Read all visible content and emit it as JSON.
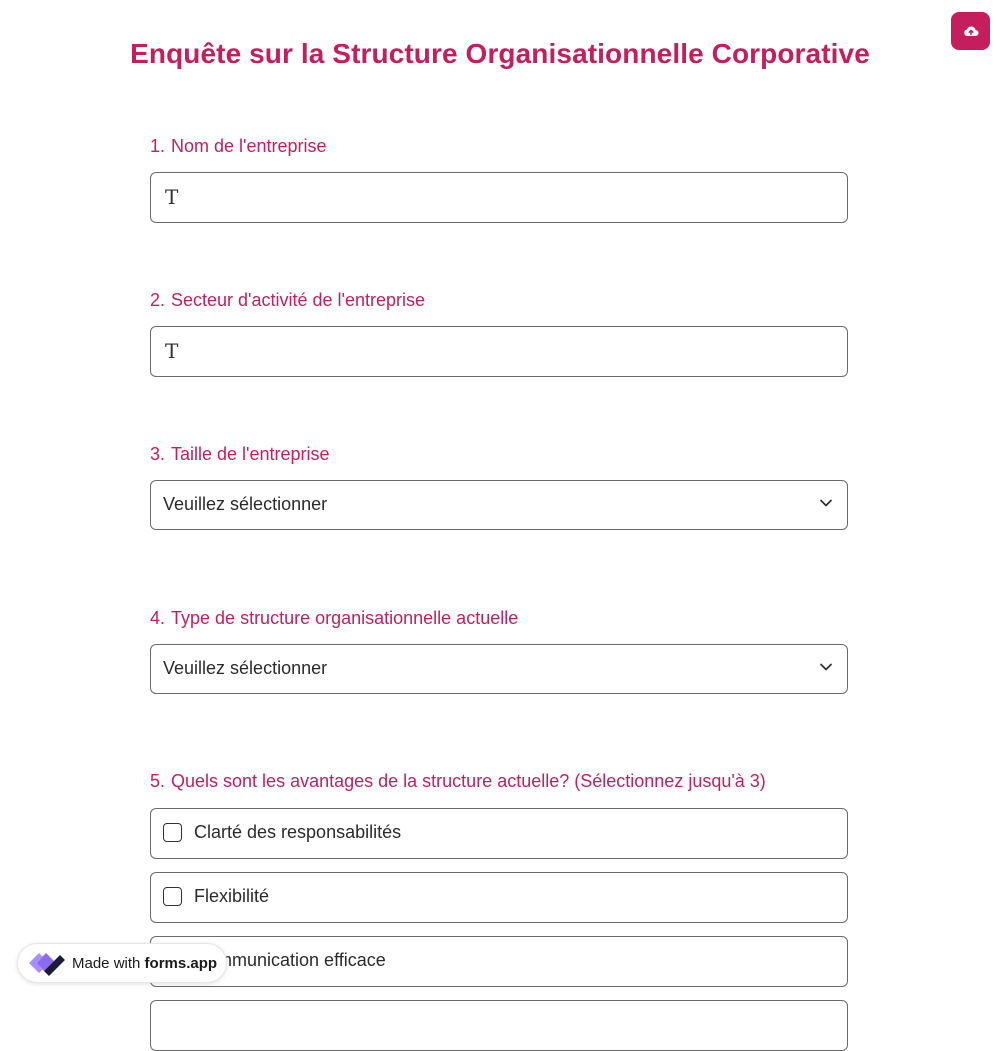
{
  "survey": {
    "title": "Enquête sur la Structure Organisationnelle Corporative"
  },
  "header": {
    "upload_icon": "cloud-upload-icon"
  },
  "questions": [
    {
      "number": "1.",
      "label": "Nom de l'entreprise",
      "type": "text",
      "value": "",
      "icon": "text-type-icon"
    },
    {
      "number": "2.",
      "label": "Secteur d'activité de l'entreprise",
      "type": "text",
      "value": "",
      "icon": "text-type-icon"
    },
    {
      "number": "3.",
      "label": "Taille de l'entreprise",
      "type": "select",
      "placeholder": "Veuillez sélectionner"
    },
    {
      "number": "4.",
      "label": "Type de structure organisationnelle actuelle",
      "type": "select",
      "placeholder": "Veuillez sélectionner"
    },
    {
      "number": "5.",
      "label": "Quels sont les avantages de la structure actuelle? (Sélectionnez jusqu'à 3)",
      "type": "checkbox",
      "options": [
        "Clarté des responsabilités",
        "Flexibilité",
        "Communication efficace"
      ]
    }
  ],
  "badge": {
    "prefix": "Made with",
    "brand": "forms.app"
  },
  "colors": {
    "accent": "#c51e5c",
    "border": "#6b6b6b",
    "logo_purple": "#8b6cf0",
    "logo_dark": "#1c1c3a"
  }
}
